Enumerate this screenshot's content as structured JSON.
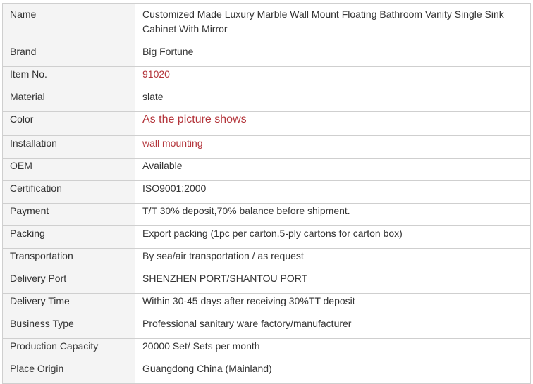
{
  "rows": [
    {
      "label": "Name",
      "value": "Customized Made Luxury Marble Wall Mount Floating Bathroom Vanity Single Sink Cabinet With Mirror",
      "color": "#333333"
    },
    {
      "label": "Brand",
      "value": "Big Fortune",
      "color": "#333333"
    },
    {
      "label": "Item No.",
      "value": "91020",
      "color": "#b3343a"
    },
    {
      "label": "Material",
      "value": "slate",
      "color": "#333333"
    },
    {
      "label": "Color",
      "value": "As the picture shows",
      "color": "#b3343a"
    },
    {
      "label": "Installation",
      "value": "wall mounting",
      "color": "#b3343a"
    },
    {
      "label": "OEM",
      "value": "Available",
      "color": "#333333"
    },
    {
      "label": "Certification",
      "value": "ISO9001:2000",
      "color": "#333333"
    },
    {
      "label": "Payment",
      "value": "T/T 30% deposit,70% balance before shipment.",
      "color": "#333333"
    },
    {
      "label": "Packing",
      "value": "Export packing (1pc per carton,5-ply cartons for carton box)",
      "color": "#333333"
    },
    {
      "label": "Transportation",
      "value": "By sea/air transportation / as request",
      "color": "#333333"
    },
    {
      "label": "Delivery Port",
      "value": "SHENZHEN PORT/SHANTOU PORT",
      "color": "#333333"
    },
    {
      "label": "Delivery Time",
      "value": "Within 30-45 days after receiving 30%TT deposit",
      "color": "#333333"
    },
    {
      "label": "Business Type",
      "value": "Professional sanitary ware factory/manufacturer",
      "color": "#333333"
    },
    {
      "label": "Production Capacity",
      "value": "20000 Set/ Sets per month",
      "color": "#333333"
    },
    {
      "label": "Place Origin",
      "value": "Guangdong China (Mainland)",
      "color": "#333333"
    }
  ]
}
